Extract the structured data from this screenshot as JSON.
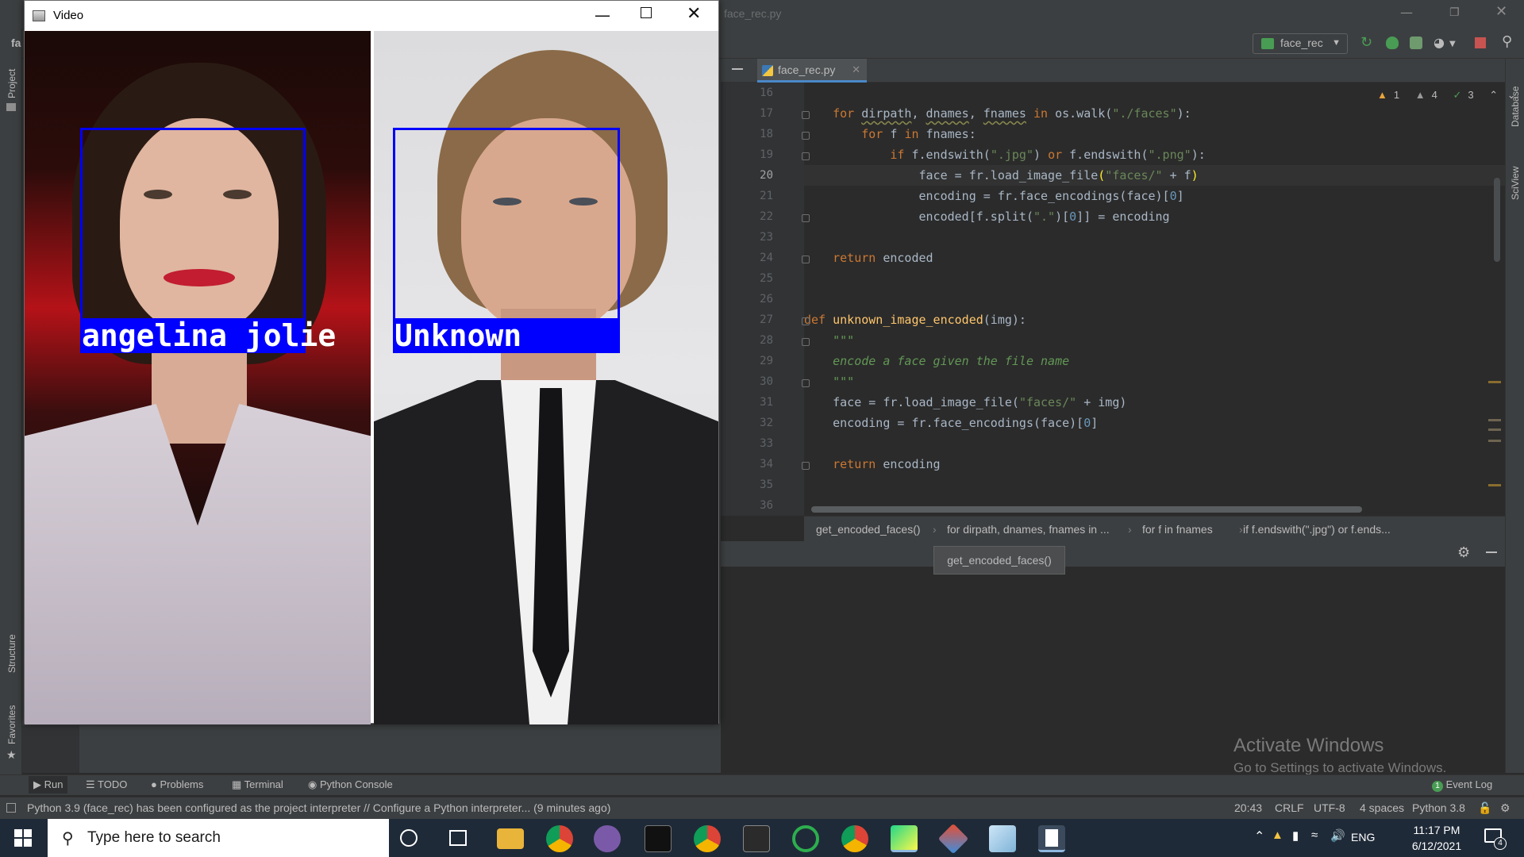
{
  "ide": {
    "title": "face_rec.py",
    "left_strip_top": "fa",
    "run_config": "face_rec",
    "left_labels": {
      "project": "Project",
      "structure": "Structure",
      "favorites": "Favorites"
    },
    "right_labels": {
      "database": "Database",
      "sciview": "SciView"
    },
    "tab": {
      "label": "face_rec.py"
    },
    "inspections": {
      "warnings": "1",
      "weak_warnings": "4",
      "ok": "3"
    },
    "code": {
      "line_numbers": [
        "16",
        "17",
        "18",
        "19",
        "20",
        "21",
        "22",
        "23",
        "24",
        "25",
        "26",
        "27",
        "28",
        "29",
        "30",
        "31",
        "32",
        "33",
        "34",
        "35",
        "36"
      ],
      "current_line": "20"
    },
    "breadcrumbs": [
      "get_encoded_faces()",
      "for dirpath, dnames, fnames in ...",
      "for f in fnames",
      "if f.endswith(\".jpg\") or f.ends..."
    ],
    "tooltip": "get_encoded_faces()",
    "activate_windows": {
      "title": "Activate Windows",
      "subtitle": "Go to Settings to activate Windows."
    },
    "bottom_tabs": [
      "Run",
      "TODO",
      "Problems",
      "Terminal",
      "Python Console"
    ],
    "event_log": "Event Log",
    "event_log_count": "1",
    "status": {
      "message": "Python 3.9 (face_rec) has been configured as the project interpreter // Configure a Python interpreter... (9 minutes ago)",
      "position": "20:43",
      "line_sep": "CRLF",
      "encoding": "UTF-8",
      "indent": "4 spaces",
      "interpreter": "Python 3.8"
    }
  },
  "video_window": {
    "title": "Video",
    "labels": {
      "left": "angelina jolie",
      "right": "Unknown"
    }
  },
  "taskbar": {
    "search_placeholder": "Type here to search",
    "language": "ENG",
    "time": "11:17 PM",
    "date": "6/12/2021",
    "notifications": "4"
  },
  "colors": {
    "accent": "#4a88c7",
    "box": "#0000ff",
    "keyword": "#cc7832",
    "string": "#6a8759"
  }
}
